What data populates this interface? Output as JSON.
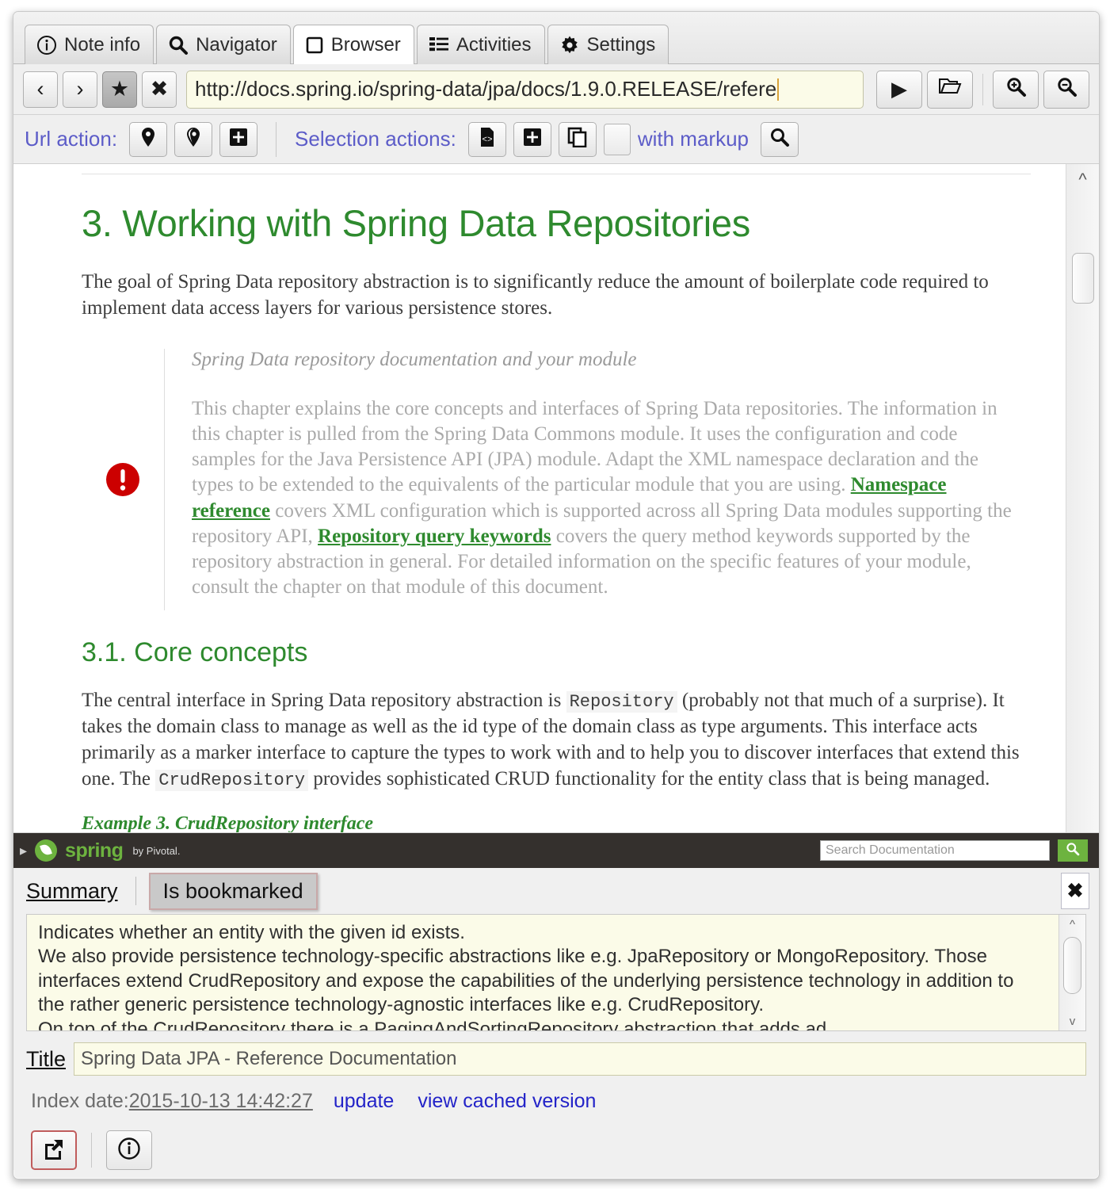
{
  "tabs": [
    {
      "label": "Note info",
      "icon": "info-circle-icon",
      "active": false
    },
    {
      "label": "Navigator",
      "icon": "magnifier-icon",
      "active": false
    },
    {
      "label": "Browser",
      "icon": "square-outline-icon",
      "active": true
    },
    {
      "label": "Activities",
      "icon": "list-lines-icon",
      "active": false
    },
    {
      "label": "Settings",
      "icon": "gear-icon",
      "active": false
    }
  ],
  "urlbar": {
    "back_label": "‹",
    "forward_label": "›",
    "bookmark_label": "★",
    "stop_label": "✖",
    "url": "http://docs.spring.io/spring-data/jpa/docs/1.9.0.RELEASE/refere",
    "go_label": "▶",
    "open_label": "open-folder-icon",
    "zoom_in_label": "zoom-in-icon",
    "zoom_out_label": "zoom-out-icon"
  },
  "actionbar": {
    "url_action_label": "Url action:",
    "selection_action_label": "Selection actions:",
    "with_markup_label": "with markup",
    "url_buttons": [
      "pin-filled-icon",
      "pin-outline-icon",
      "pin-plus-icon"
    ],
    "selection_buttons": [
      "code-page-icon",
      "add-page-icon",
      "copy-icon"
    ],
    "search_button": "magnifier-icon"
  },
  "document": {
    "h1": "3. Working with Spring Data Repositories",
    "intro": "The goal of Spring Data repository abstraction is to significantly reduce the amount of boilerplate code required to implement data access layers for various persistence stores.",
    "admonition": {
      "icon": "important-exclamation-icon",
      "title": "Spring Data repository documentation and your module",
      "p1": "This chapter explains the core concepts and interfaces of Spring Data repositories. The information in this chapter is pulled from the Spring Data Commons module. It uses the configuration and code samples for the Java Persistence API (JPA) module. Adapt the XML namespace declaration and the types to be extended to the equivalents of the particular module that you are using. ",
      "link1": "Namespace reference",
      "p2": " covers XML configuration which is supported across all Spring Data modules supporting the repository API, ",
      "link2": "Repository query keywords",
      "p3": " covers the query method keywords supported by the repository abstraction in general. For detailed information on the specific features of your module, consult the chapter on that module of this document."
    },
    "h2": "3.1. Core concepts",
    "core_p_a": "The central interface in Spring Data repository abstraction is ",
    "core_code_1": "Repository",
    "core_p_b": " (probably not that much of a surprise). It takes the domain class to manage as well as the id type of the domain class as type arguments. This interface acts primarily as a marker interface to capture the types to work with and to help you to discover interfaces that extend this one. The ",
    "core_code_2": "CrudRepository",
    "core_p_c": " provides sophisticated CRUD functionality for the entity class that is being managed.",
    "example_caption": "Example 3. CrudRepository interface"
  },
  "springbar": {
    "brand": "spring",
    "brand_suffix": "by Pivotal.",
    "search_placeholder": "Search Documentation",
    "search_icon": "magnifier-icon",
    "caret_icon": "chevron-right-icon"
  },
  "detail": {
    "tab_summary": "Summary",
    "tab_bookmarked": "Is bookmarked",
    "close_label": "✖",
    "summary_lines": [
      "Indicates whether an entity with the given id exists.",
      "We also provide persistence technology-specific abstractions like e.g. JpaRepository or MongoRepository. Those",
      "interfaces extend CrudRepository and expose the capabilities of the underlying persistence technology in addition to",
      "the rather generic persistence technology-agnostic interfaces like e.g. CrudRepository.",
      "On top of the CrudRepository there is a PagingAndSortingRepository abstraction that adds ad..."
    ],
    "title_label": "Title",
    "title_value": "Spring Data JPA - Reference Documentation",
    "index_date_label": "Index date:",
    "index_date_value": "2015-10-13 14:42:27",
    "update_link": "update",
    "cached_link": "view cached version",
    "open_external_icon": "external-link-icon",
    "info_icon": "info-circle-icon"
  },
  "colors": {
    "accent_green": "#2e8a2e",
    "spring_green": "#6db33f",
    "link_blue": "#2323c8",
    "action_purple": "#5c5cc8",
    "field_cream": "#fbfbe8",
    "selected_tab_border": "#c9a8a8",
    "dark_bar": "#34302d"
  }
}
